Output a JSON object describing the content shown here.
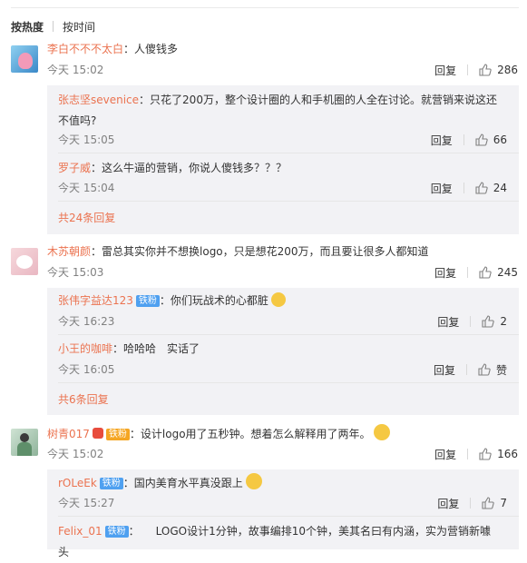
{
  "sort": {
    "hot": "按热度",
    "time": "按时间"
  },
  "common": {
    "reply": "回复"
  },
  "comments": [
    {
      "user": "李白不不不太白",
      "text": "：人傻钱多",
      "time": "今天 15:02",
      "likes": "286",
      "replies": [
        {
          "user": "张志坚sevenice",
          "text": "：只花了200万，整个设计圈的人和手机圈的人全在讨论。就营销来说这还不值吗?",
          "time": "今天 15:05",
          "likes": "66"
        },
        {
          "user": "罗子威",
          "text": "：这么牛逼的营销，你说人傻钱多？？？",
          "time": "今天 15:04",
          "likes": "24"
        }
      ],
      "more": "共24条回复"
    },
    {
      "user": "木苏朝颜",
      "text": "：雷总其实你并不想换logo，只是想花200万，而且要让很多人都知道",
      "time": "今天 15:03",
      "likes": "245",
      "replies": [
        {
          "user": "张伟字益达123",
          "badge": "铁粉",
          "text": "：你们玩战术的心都脏",
          "time": "今天 16:23",
          "likes": "2"
        },
        {
          "user": "小王的咖啡",
          "text": "：哈哈哈　实话了",
          "time": "今天 16:05",
          "likes": "赞"
        }
      ],
      "more": "共6条回复"
    },
    {
      "user": "树青017",
      "badge": "铁粉",
      "text": "：设计logo用了五秒钟。想着怎么解释用了两年。",
      "time": "今天 15:02",
      "likes": "166",
      "replies": [
        {
          "user": "rOLeEk",
          "badge": "铁粉",
          "text": "：国内美育水平真没跟上",
          "time": "今天 15:27",
          "likes": "7"
        },
        {
          "user": "Felix_01",
          "badge": "铁粉",
          "text": "：　　LOGO设计1分钟，故事编排10个钟，美其名曰有内涵，实为营销新噱头"
        }
      ]
    }
  ],
  "colors": {
    "name": "#eb7350",
    "badge": "#4fa0f0",
    "subbg": "#f2f2f5"
  }
}
